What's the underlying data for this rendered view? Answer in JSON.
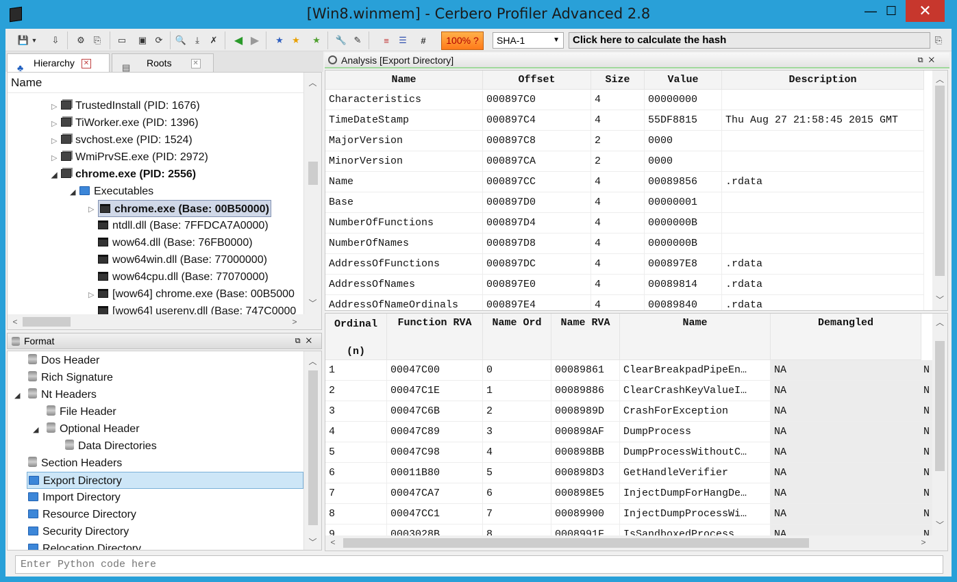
{
  "window": {
    "title": "[Win8.winmem] - Cerbero Profiler Advanced 2.8",
    "min": "—",
    "max": "☐",
    "close": "✕"
  },
  "toolbar": {
    "zoom": "100% ?",
    "hash_algo": "SHA-1",
    "hash_button": "Click here to calculate the hash"
  },
  "tabs": [
    {
      "label": "Hierarchy",
      "close": "✕"
    },
    {
      "label": "Roots",
      "close": "✕"
    }
  ],
  "hierarchy": {
    "column": "Name",
    "items": [
      {
        "label": "TrustedInstall (PID: 1676)"
      },
      {
        "label": "TiWorker.exe (PID: 1396)"
      },
      {
        "label": "svchost.exe (PID: 1524)"
      },
      {
        "label": "WmiPrvSE.exe (PID: 2972)"
      },
      {
        "label": "chrome.exe (PID: 2556)"
      },
      {
        "label": "Executables"
      },
      {
        "label": "chrome.exe (Base: 00B50000)"
      },
      {
        "label": "ntdll.dll (Base: 7FFDCA7A0000)"
      },
      {
        "label": "wow64.dll (Base: 76FB0000)"
      },
      {
        "label": "wow64win.dll (Base: 77000000)"
      },
      {
        "label": "wow64cpu.dll (Base: 77070000)"
      },
      {
        "label": "[wow64] chrome.exe (Base: 00B5000"
      },
      {
        "label": "[wow64] userenv.dll (Base: 747C0000"
      }
    ]
  },
  "format": {
    "title": "Format",
    "items": [
      {
        "label": "Dos Header"
      },
      {
        "label": "Rich Signature"
      },
      {
        "label": "Nt Headers"
      },
      {
        "label": "File Header"
      },
      {
        "label": "Optional Header"
      },
      {
        "label": "Data Directories"
      },
      {
        "label": "Section Headers"
      },
      {
        "label": "Export Directory"
      },
      {
        "label": "Import Directory"
      },
      {
        "label": "Resource Directory"
      },
      {
        "label": "Security Directory"
      },
      {
        "label": "Relocation Directory"
      }
    ]
  },
  "analysis": {
    "title": "Analysis [Export Directory]",
    "columns": [
      "Name",
      "Offset",
      "Size",
      "Value",
      "Description"
    ],
    "rows": [
      [
        "Characteristics",
        "000897C0",
        "4",
        "00000000",
        ""
      ],
      [
        "TimeDateStamp",
        "000897C4",
        "4",
        "55DF8815",
        "Thu Aug 27 21:58:45 2015 GMT"
      ],
      [
        "MajorVersion",
        "000897C8",
        "2",
        "0000",
        ""
      ],
      [
        "MinorVersion",
        "000897CA",
        "2",
        "0000",
        ""
      ],
      [
        "Name",
        "000897CC",
        "4",
        "00089856",
        ".rdata"
      ],
      [
        "Base",
        "000897D0",
        "4",
        "00000001",
        ""
      ],
      [
        "NumberOfFunctions",
        "000897D4",
        "4",
        "0000000B",
        ""
      ],
      [
        "NumberOfNames",
        "000897D8",
        "4",
        "0000000B",
        ""
      ],
      [
        "AddressOfFunctions",
        "000897DC",
        "4",
        "000897E8",
        ".rdata"
      ],
      [
        "AddressOfNames",
        "000897E0",
        "4",
        "00089814",
        ".rdata"
      ],
      [
        "AddressOfNameOrdinals",
        "000897E4",
        "4",
        "00089840",
        ".rdata"
      ]
    ]
  },
  "exports": {
    "columns": [
      "Ordinal",
      "Function RVA",
      "Name Ord",
      "Name RVA",
      "Name",
      "Demangled"
    ],
    "ordinal_sub": "(n)",
    "rows": [
      [
        "1",
        "00047C00",
        "0",
        "00089861",
        "ClearBreakpadPipeEn…",
        "NA",
        "N"
      ],
      [
        "2",
        "00047C1E",
        "1",
        "00089886",
        "ClearCrashKeyValueI…",
        "NA",
        "N"
      ],
      [
        "3",
        "00047C6B",
        "2",
        "0008989D",
        "CrashForException",
        "NA",
        "N"
      ],
      [
        "4",
        "00047C89",
        "3",
        "000898AF",
        "DumpProcess",
        "NA",
        "N"
      ],
      [
        "5",
        "00047C98",
        "4",
        "000898BB",
        "DumpProcessWithoutC…",
        "NA",
        "N"
      ],
      [
        "6",
        "00011B80",
        "5",
        "000898D3",
        "GetHandleVerifier",
        "NA",
        "N"
      ],
      [
        "7",
        "00047CA7",
        "6",
        "000898E5",
        "InjectDumpForHangDe…",
        "NA",
        "N"
      ],
      [
        "8",
        "00047CC1",
        "7",
        "00089900",
        "InjectDumpProcessWi…",
        "NA",
        "N"
      ],
      [
        "9",
        "0003028B",
        "8",
        "0008991F",
        "IsSandboxedProcess",
        "NA",
        "N"
      ]
    ]
  },
  "python": {
    "placeholder": "Enter Python code here"
  }
}
